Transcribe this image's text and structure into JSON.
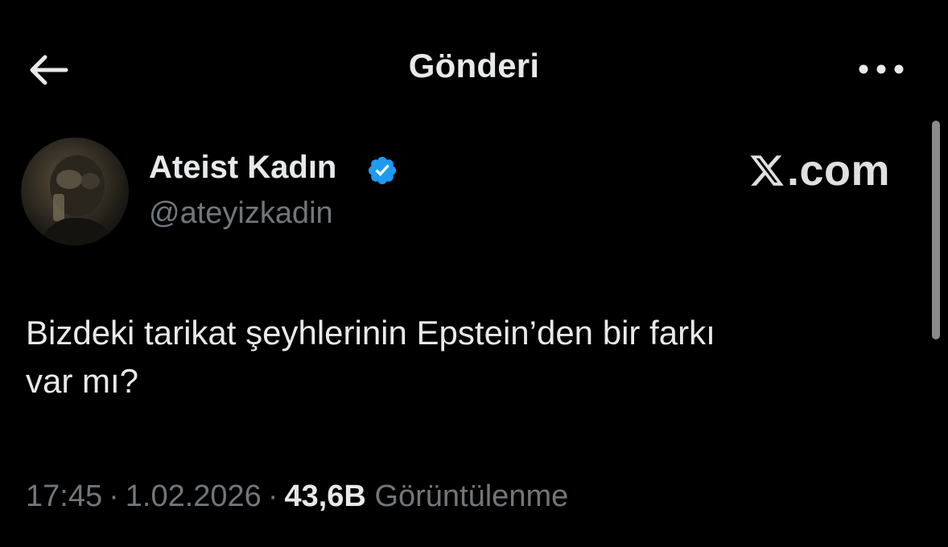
{
  "header": {
    "title": "Gönderi",
    "back_icon": "arrow-left-icon",
    "more_icon": "ellipsis-horizontal-icon"
  },
  "author": {
    "name": "Ateist Kadın",
    "handle": "@ateyizkadin",
    "verified_icon": "verified-badge-icon",
    "verified_color": "#1d9bf0"
  },
  "watermark": {
    "brand_icon": "x-logo-icon",
    "text": ".com"
  },
  "tweet": {
    "text_line1": "Bizdeki tarikat şeyhlerinin Epstein’den bir farkı",
    "text_line2": "var mı?",
    "time": "17:45",
    "separator": "·",
    "date": "1.02.2026",
    "views_count": "43,6B",
    "views_label": "Görüntülenme"
  },
  "colors": {
    "background": "#000000",
    "primary_text": "#e7e9ea",
    "secondary_text": "#71767b",
    "accent": "#1d9bf0"
  }
}
